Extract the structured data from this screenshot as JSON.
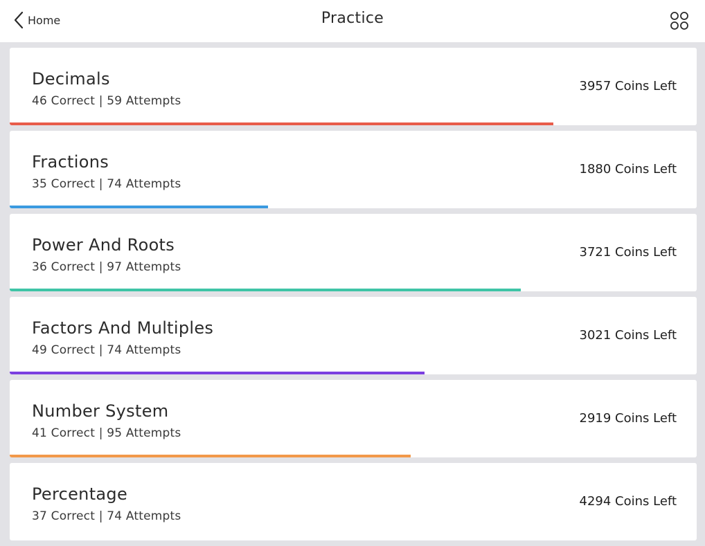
{
  "header": {
    "back_label": "Home",
    "title": "Practice"
  },
  "topics": [
    {
      "name": "Decimals",
      "stats": "46 Correct | 59 Attempts",
      "coins": "3957 Coins Left",
      "progress": 0.791,
      "color": "#e85c4a"
    },
    {
      "name": "Fractions",
      "stats": "35 Correct | 74 Attempts",
      "coins": "1880 Coins Left",
      "progress": 0.376,
      "color": "#3a9ae0"
    },
    {
      "name": "Power And Roots",
      "stats": "36 Correct | 97 Attempts",
      "coins": "3721 Coins Left",
      "progress": 0.744,
      "color": "#3fc4a6"
    },
    {
      "name": "Factors And Multiples",
      "stats": "49 Correct | 74 Attempts",
      "coins": "3021 Coins Left",
      "progress": 0.604,
      "color": "#7b3fe0"
    },
    {
      "name": "Number System",
      "stats": "41 Correct | 95 Attempts",
      "coins": "2919 Coins Left",
      "progress": 0.584,
      "color": "#f2994a"
    },
    {
      "name": "Percentage",
      "stats": "37 Correct | 74 Attempts",
      "coins": "4294 Coins Left",
      "progress": 0.0,
      "color": "#e85c4a"
    }
  ]
}
